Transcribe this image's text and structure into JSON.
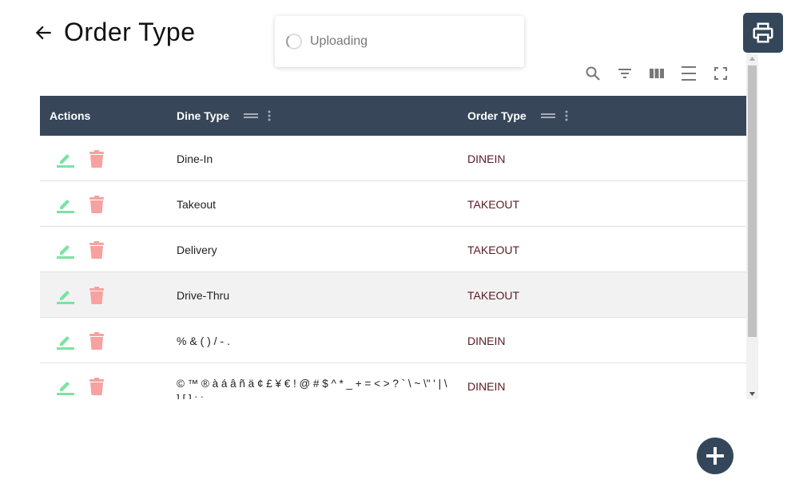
{
  "header": {
    "title": "Order Type"
  },
  "toast": {
    "text": "Uploading"
  },
  "table": {
    "columns": [
      "Actions",
      "Dine Type",
      "Order Type"
    ],
    "rows": [
      {
        "dine_type": "Dine-In",
        "order_type": "DINEIN"
      },
      {
        "dine_type": "Takeout",
        "order_type": "TAKEOUT"
      },
      {
        "dine_type": "Delivery",
        "order_type": "TAKEOUT"
      },
      {
        "dine_type": "Drive-Thru",
        "order_type": "TAKEOUT"
      },
      {
        "dine_type": "% & ( ) / - .",
        "order_type": "DINEIN"
      },
      {
        "dine_type": "© ™ ® à á â ñ ä ¢ £ ¥ € ! @ # $ ^ * _ + = < > ? ` \\ ~ \\\" ' | \\ ] [ ] : ;",
        "order_type": "DINEIN"
      }
    ]
  },
  "colors": {
    "header_bg": "#374759",
    "edit": "#7be3a3",
    "delete": "#f7a1a1"
  }
}
